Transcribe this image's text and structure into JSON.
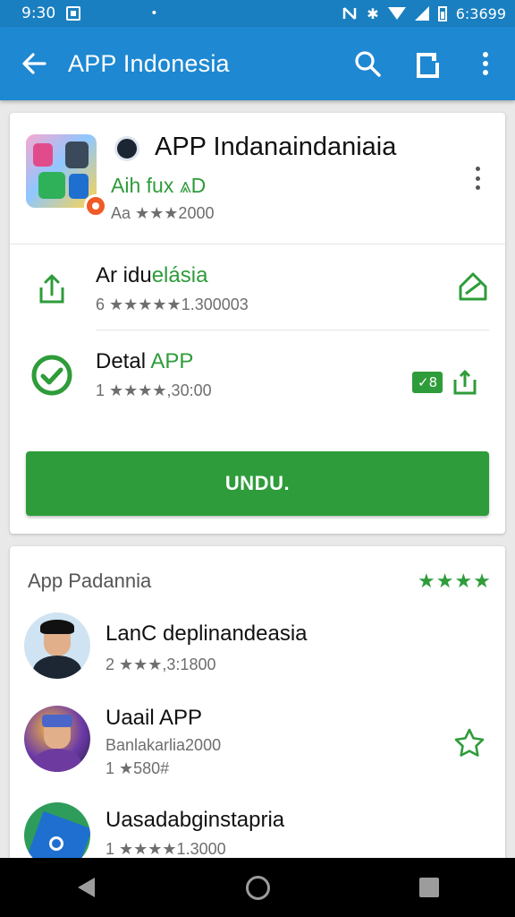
{
  "status_bar": {
    "time": "9:30",
    "dot": "•",
    "bluetooth": "✱",
    "battery_text": "6:3699"
  },
  "app_bar": {
    "title": "APP Indonesia",
    "back_icon": "arrow-back-icon",
    "actions": [
      "search-icon",
      "share-icon",
      "more-vert-icon"
    ]
  },
  "app": {
    "title": "APP Indanaindaniaia",
    "subtitle": "Aih fux ⩓D",
    "rating_text": "Aa ★★★2000",
    "install_label": "UNDU."
  },
  "rows": [
    {
      "title_plain": "Ar idu",
      "title_green": "elásia",
      "meta": "6 ★★★★★1.300003",
      "icon": "share-upload-icon",
      "right_icon": "install-tag-icon"
    },
    {
      "title_plain": "Detal ",
      "title_green": "APP",
      "meta": "1 ★★★★,30:00",
      "icon": "check-circle-icon",
      "badge": "✓8",
      "right_icon": "share-upload-icon"
    }
  ],
  "section": {
    "title": "App Padannia",
    "stars": "★★★★"
  },
  "list": [
    {
      "title": "LanC deplinandeasia",
      "meta": "2 ★★★,3:1800"
    },
    {
      "title": "Uaail APP",
      "meta": "Banlakarlia2000",
      "meta2": "1 ★580#"
    },
    {
      "title": "Uasadabginstapria",
      "meta": "1 ★★★★1.3000"
    }
  ],
  "colors": {
    "app_bar": "#1e88d2",
    "status_bar": "#1a7fc0",
    "accent_green": "#2e9c3a"
  }
}
